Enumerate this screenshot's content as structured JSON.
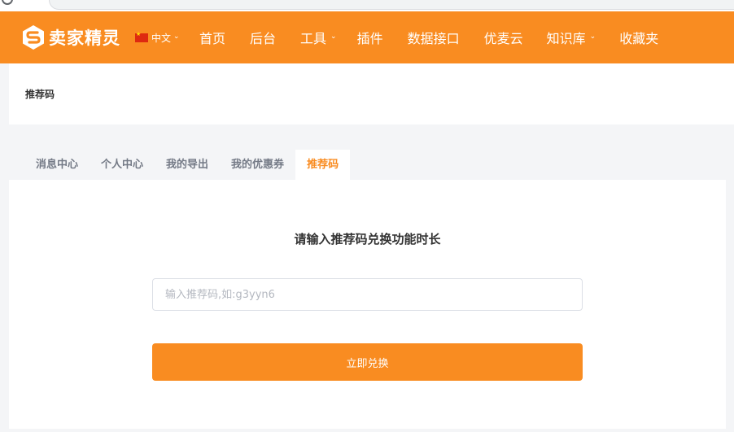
{
  "brand": {
    "name": "卖家精灵",
    "primary_color": "#f98c21"
  },
  "lang": {
    "label": "中文",
    "flag_icon": "china-flag-icon"
  },
  "nav": {
    "items": [
      {
        "label": "首页",
        "has_dropdown": false
      },
      {
        "label": "后台",
        "has_dropdown": false
      },
      {
        "label": "工具",
        "has_dropdown": true
      },
      {
        "label": "插件",
        "has_dropdown": false
      },
      {
        "label": "数据接口",
        "has_dropdown": false
      },
      {
        "label": "优麦云",
        "has_dropdown": false
      },
      {
        "label": "知识库",
        "has_dropdown": true
      },
      {
        "label": "收藏夹",
        "has_dropdown": false
      }
    ]
  },
  "page": {
    "title": "推荐码"
  },
  "tabs": [
    {
      "label": "消息中心",
      "active": false
    },
    {
      "label": "个人中心",
      "active": false
    },
    {
      "label": "我的导出",
      "active": false
    },
    {
      "label": "我的优惠券",
      "active": false
    },
    {
      "label": "推荐码",
      "active": true
    }
  ],
  "redeem": {
    "heading": "请输入推荐码兑换功能时长",
    "input_placeholder": "输入推荐码,如:g3yyn6",
    "input_value": "",
    "button_label": "立即兑换"
  }
}
